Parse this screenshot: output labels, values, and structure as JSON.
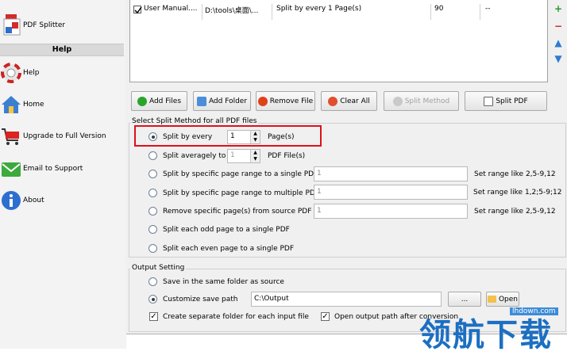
{
  "sidebar": {
    "pdf_splitter": "PDF Splitter",
    "help_header": "Help",
    "items": [
      {
        "label": "Help"
      },
      {
        "label": "Home"
      },
      {
        "label": "Upgrade to Full Version"
      },
      {
        "label": "Email to Support"
      },
      {
        "label": "About"
      }
    ]
  },
  "file_list": {
    "rows": [
      {
        "name": "User Manual....",
        "path": "D:\\tools\\桌面\\...",
        "method": "Split by every 1 Page(s)",
        "pages": "90",
        "status": "--"
      }
    ]
  },
  "toolbar": {
    "add_files": "Add Files",
    "add_folder": "Add Folder",
    "remove_file": "Remove File",
    "clear_all": "Clear All",
    "split_method": "Split Method",
    "split_pdf": "Split PDF"
  },
  "split_group": {
    "title": "Select Split Method for all PDF files",
    "every_label": "Split by every",
    "every_value": "1",
    "every_unit": "Page(s)",
    "avg_label": "Split averagely to",
    "avg_value": "1",
    "avg_unit": "PDF File(s)",
    "range_single": "Split by specific page range to a single PDF",
    "range_single_placeholder": "1",
    "range_single_hint": "Set range like 2,5-9,12",
    "range_multi": "Split by specific page range to multiple PDF",
    "range_multi_placeholder": "1",
    "range_multi_hint": "Set range like 1,2;5-9;12",
    "remove_pages": "Remove specific page(s) from source PDF",
    "remove_placeholder": "1",
    "remove_hint": "Set range like 2,5-9,12",
    "odd": "Split each odd page to a single PDF",
    "even": "Split each even page to a single PDF"
  },
  "output_group": {
    "title": "Output Setting",
    "same_folder": "Save in the same folder as source",
    "customize": "Customize save path",
    "path_value": "C:\\Output",
    "browse": "...",
    "open": "Open",
    "separate_folder": "Create separate folder for each input file",
    "open_after": "Open output path after conversion"
  },
  "watermark": {
    "text": "领航下载",
    "url": "lhdown.com"
  }
}
